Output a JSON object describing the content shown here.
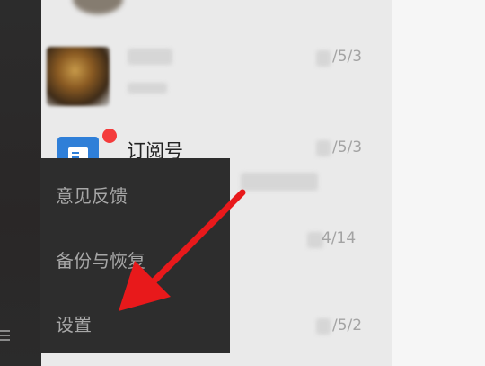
{
  "chat_list": {
    "items": [
      {
        "date": "/5/3"
      },
      {
        "name": "订阅号",
        "date": "/5/3"
      },
      {
        "date": "4/14"
      },
      {
        "date": "/5/2"
      }
    ]
  },
  "context_menu": {
    "items": [
      {
        "label": "意见反馈"
      },
      {
        "label": "备份与恢复"
      },
      {
        "label": "设置"
      }
    ]
  },
  "icons": {
    "sidebar_menu": "hamburger-icon",
    "mute": "bell-muted-icon",
    "subscription": "subscription-doc-icon"
  },
  "colors": {
    "sidebar": "#2c2c2c",
    "menu_bg": "#2d2d2d",
    "menu_text": "#a7a7a7",
    "badge": "#f43b3b",
    "subscription_icon": "#2f7fd8",
    "annotation_arrow": "#e8191b"
  }
}
